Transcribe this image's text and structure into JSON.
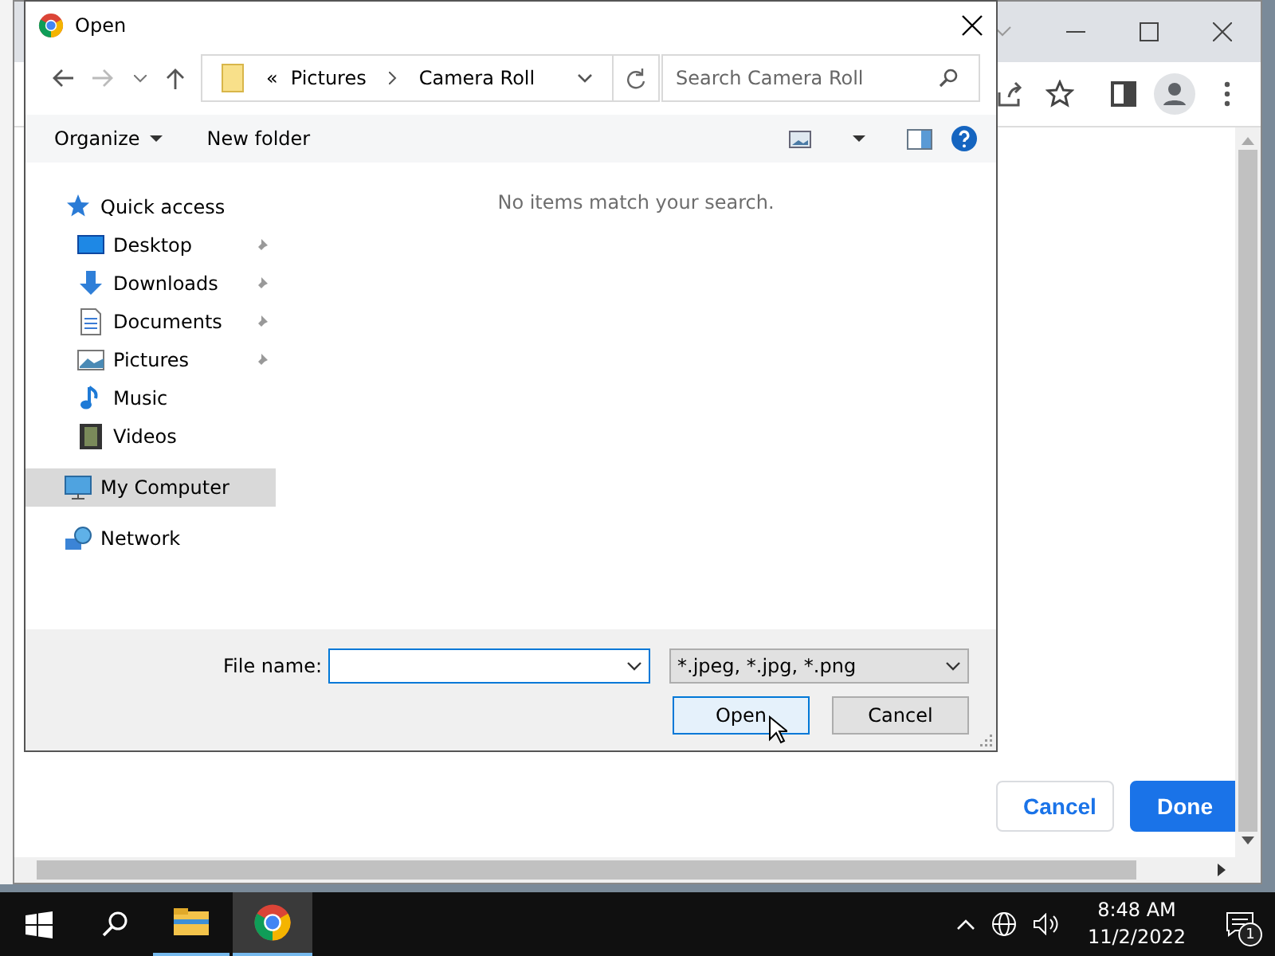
{
  "browser": {
    "buttons": [
      {
        "label": "Cancel",
        "kind": "secondary"
      },
      {
        "label": "Done",
        "kind": "primary"
      }
    ]
  },
  "dialog": {
    "title": "Open",
    "address": {
      "overflow": "«",
      "path": [
        "Pictures",
        "Camera Roll"
      ]
    },
    "search": {
      "placeholder": "Search Camera Roll"
    },
    "toolbar": [
      {
        "label": "Organize",
        "kind": "menu"
      },
      {
        "label": "New folder",
        "kind": "button"
      }
    ],
    "sidebar": [
      {
        "label": "Quick access",
        "kind": "star",
        "selected": false,
        "children": [
          {
            "label": "Desktop",
            "kind": "desktop",
            "pinned": true
          },
          {
            "label": "Downloads",
            "kind": "download",
            "pinned": true
          },
          {
            "label": "Documents",
            "kind": "document",
            "pinned": true
          },
          {
            "label": "Pictures",
            "kind": "pictures",
            "pinned": true
          },
          {
            "label": "Music",
            "kind": "music",
            "pinned": false
          },
          {
            "label": "Videos",
            "kind": "videos",
            "pinned": false
          }
        ]
      },
      {
        "label": "My Computer",
        "kind": "computer",
        "selected": true
      },
      {
        "label": "Network",
        "kind": "network",
        "selected": false
      }
    ],
    "empty_message": "No items match your search.",
    "file_name": {
      "label": "File name:"
    },
    "file_type": {
      "value": "*.jpeg, *.jpg, *.png"
    },
    "buttons": [
      {
        "label": "Open",
        "focused": true
      },
      {
        "label": "Cancel",
        "focused": false
      }
    ]
  },
  "taskbar": {
    "apps": [
      {
        "kind": "explorer",
        "selected": false
      },
      {
        "kind": "chrome",
        "selected": true
      }
    ],
    "time": "8:48 AM",
    "date": "11/2/2022",
    "notifications": "1"
  }
}
